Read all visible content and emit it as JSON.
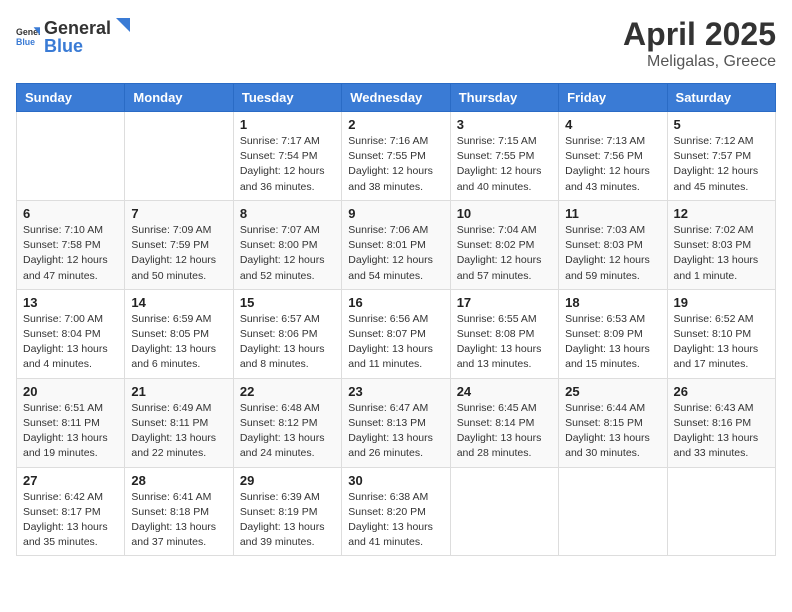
{
  "header": {
    "logo_general": "General",
    "logo_blue": "Blue",
    "month": "April 2025",
    "location": "Meligalas, Greece"
  },
  "days_of_week": [
    "Sunday",
    "Monday",
    "Tuesday",
    "Wednesday",
    "Thursday",
    "Friday",
    "Saturday"
  ],
  "weeks": [
    [
      {
        "day": "",
        "info": ""
      },
      {
        "day": "",
        "info": ""
      },
      {
        "day": "1",
        "info": "Sunrise: 7:17 AM\nSunset: 7:54 PM\nDaylight: 12 hours and 36 minutes."
      },
      {
        "day": "2",
        "info": "Sunrise: 7:16 AM\nSunset: 7:55 PM\nDaylight: 12 hours and 38 minutes."
      },
      {
        "day": "3",
        "info": "Sunrise: 7:15 AM\nSunset: 7:55 PM\nDaylight: 12 hours and 40 minutes."
      },
      {
        "day": "4",
        "info": "Sunrise: 7:13 AM\nSunset: 7:56 PM\nDaylight: 12 hours and 43 minutes."
      },
      {
        "day": "5",
        "info": "Sunrise: 7:12 AM\nSunset: 7:57 PM\nDaylight: 12 hours and 45 minutes."
      }
    ],
    [
      {
        "day": "6",
        "info": "Sunrise: 7:10 AM\nSunset: 7:58 PM\nDaylight: 12 hours and 47 minutes."
      },
      {
        "day": "7",
        "info": "Sunrise: 7:09 AM\nSunset: 7:59 PM\nDaylight: 12 hours and 50 minutes."
      },
      {
        "day": "8",
        "info": "Sunrise: 7:07 AM\nSunset: 8:00 PM\nDaylight: 12 hours and 52 minutes."
      },
      {
        "day": "9",
        "info": "Sunrise: 7:06 AM\nSunset: 8:01 PM\nDaylight: 12 hours and 54 minutes."
      },
      {
        "day": "10",
        "info": "Sunrise: 7:04 AM\nSunset: 8:02 PM\nDaylight: 12 hours and 57 minutes."
      },
      {
        "day": "11",
        "info": "Sunrise: 7:03 AM\nSunset: 8:03 PM\nDaylight: 12 hours and 59 minutes."
      },
      {
        "day": "12",
        "info": "Sunrise: 7:02 AM\nSunset: 8:03 PM\nDaylight: 13 hours and 1 minute."
      }
    ],
    [
      {
        "day": "13",
        "info": "Sunrise: 7:00 AM\nSunset: 8:04 PM\nDaylight: 13 hours and 4 minutes."
      },
      {
        "day": "14",
        "info": "Sunrise: 6:59 AM\nSunset: 8:05 PM\nDaylight: 13 hours and 6 minutes."
      },
      {
        "day": "15",
        "info": "Sunrise: 6:57 AM\nSunset: 8:06 PM\nDaylight: 13 hours and 8 minutes."
      },
      {
        "day": "16",
        "info": "Sunrise: 6:56 AM\nSunset: 8:07 PM\nDaylight: 13 hours and 11 minutes."
      },
      {
        "day": "17",
        "info": "Sunrise: 6:55 AM\nSunset: 8:08 PM\nDaylight: 13 hours and 13 minutes."
      },
      {
        "day": "18",
        "info": "Sunrise: 6:53 AM\nSunset: 8:09 PM\nDaylight: 13 hours and 15 minutes."
      },
      {
        "day": "19",
        "info": "Sunrise: 6:52 AM\nSunset: 8:10 PM\nDaylight: 13 hours and 17 minutes."
      }
    ],
    [
      {
        "day": "20",
        "info": "Sunrise: 6:51 AM\nSunset: 8:11 PM\nDaylight: 13 hours and 19 minutes."
      },
      {
        "day": "21",
        "info": "Sunrise: 6:49 AM\nSunset: 8:11 PM\nDaylight: 13 hours and 22 minutes."
      },
      {
        "day": "22",
        "info": "Sunrise: 6:48 AM\nSunset: 8:12 PM\nDaylight: 13 hours and 24 minutes."
      },
      {
        "day": "23",
        "info": "Sunrise: 6:47 AM\nSunset: 8:13 PM\nDaylight: 13 hours and 26 minutes."
      },
      {
        "day": "24",
        "info": "Sunrise: 6:45 AM\nSunset: 8:14 PM\nDaylight: 13 hours and 28 minutes."
      },
      {
        "day": "25",
        "info": "Sunrise: 6:44 AM\nSunset: 8:15 PM\nDaylight: 13 hours and 30 minutes."
      },
      {
        "day": "26",
        "info": "Sunrise: 6:43 AM\nSunset: 8:16 PM\nDaylight: 13 hours and 33 minutes."
      }
    ],
    [
      {
        "day": "27",
        "info": "Sunrise: 6:42 AM\nSunset: 8:17 PM\nDaylight: 13 hours and 35 minutes."
      },
      {
        "day": "28",
        "info": "Sunrise: 6:41 AM\nSunset: 8:18 PM\nDaylight: 13 hours and 37 minutes."
      },
      {
        "day": "29",
        "info": "Sunrise: 6:39 AM\nSunset: 8:19 PM\nDaylight: 13 hours and 39 minutes."
      },
      {
        "day": "30",
        "info": "Sunrise: 6:38 AM\nSunset: 8:20 PM\nDaylight: 13 hours and 41 minutes."
      },
      {
        "day": "",
        "info": ""
      },
      {
        "day": "",
        "info": ""
      },
      {
        "day": "",
        "info": ""
      }
    ]
  ]
}
